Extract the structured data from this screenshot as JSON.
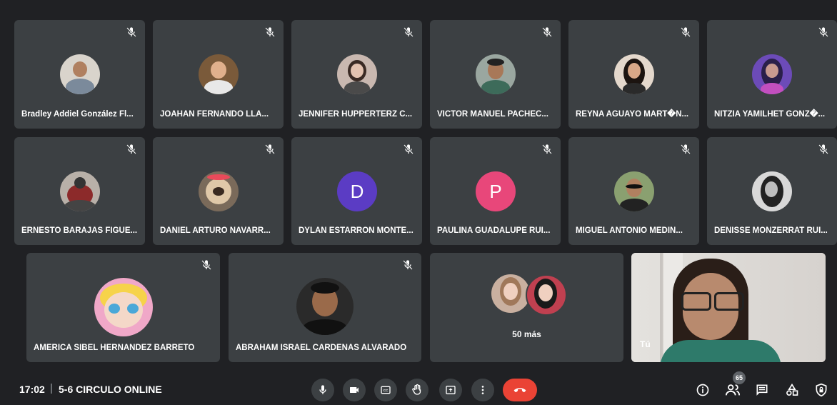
{
  "participants_row1": [
    {
      "name": "Bradley Addiel González Fl..."
    },
    {
      "name": "JOAHAN FERNANDO LLA..."
    },
    {
      "name": "JENNIFER HUPPERTERZ C..."
    },
    {
      "name": "VICTOR MANUEL PACHEC..."
    },
    {
      "name": "REYNA AGUAYO MART�N..."
    },
    {
      "name": "NITZIA YAMILHET GONZ�..."
    }
  ],
  "participants_row2": [
    {
      "name": "ERNESTO BARAJAS FIGUE..."
    },
    {
      "name": "DANIEL ARTURO NAVARR..."
    },
    {
      "name": "DYLAN ESTARRON MONTE...",
      "initial": "D",
      "color": "#5b3cc4"
    },
    {
      "name": "PAULINA GUADALUPE RUI...",
      "initial": "P",
      "color": "#e8477a"
    },
    {
      "name": "MIGUEL ANTONIO MEDIN..."
    },
    {
      "name": "DENISSE MONZERRAT RUI..."
    }
  ],
  "participants_row3": [
    {
      "name": "AMERICA SIBEL HERNANDEZ BARRETO"
    },
    {
      "name": "ABRAHAM ISRAEL CARDENAS ALVARADO"
    }
  ],
  "more_tile": {
    "label": "50 más"
  },
  "self_tile": {
    "label": "Tú"
  },
  "bottom_bar": {
    "time": "17:02",
    "separator": "|",
    "meeting_name": "5-6 CIRCULO ONLINE",
    "participant_count": "65"
  },
  "colors": {
    "background": "#202124",
    "tile": "#3c4043",
    "end_call": "#ea4335"
  }
}
